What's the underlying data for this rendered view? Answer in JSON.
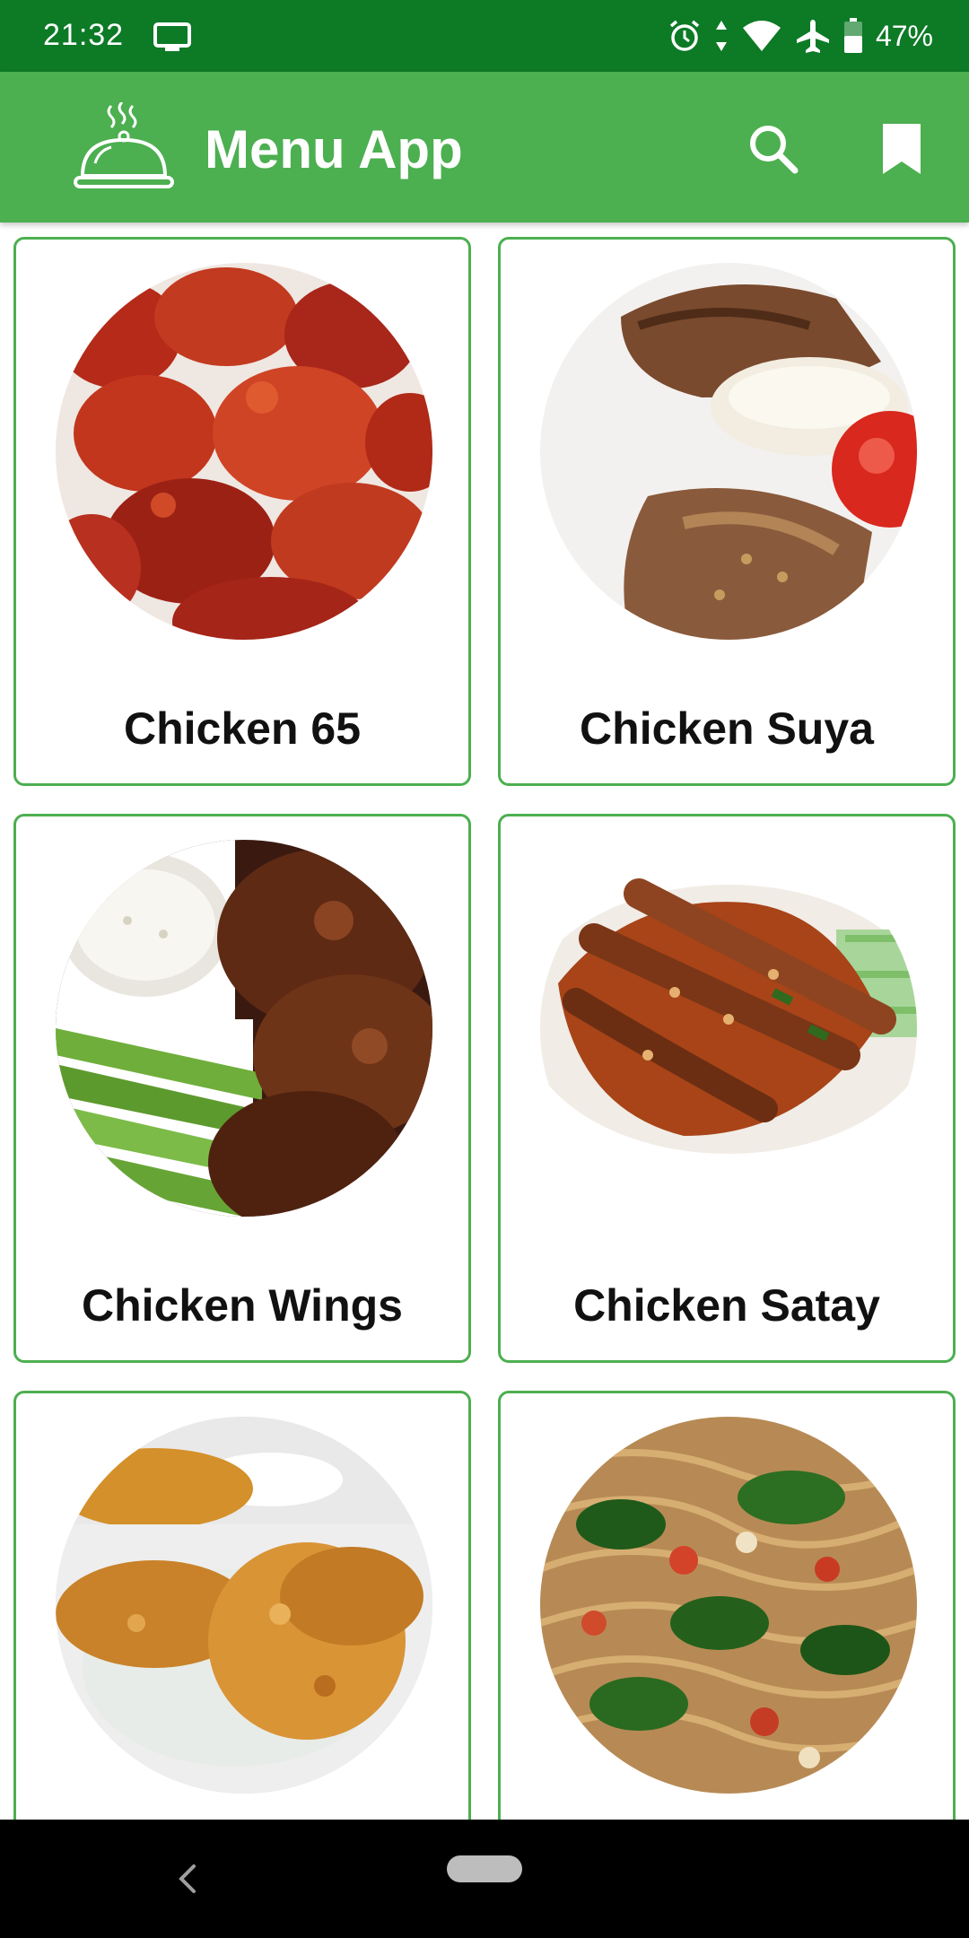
{
  "status_bar": {
    "time": "21:32",
    "battery_percent": "47%",
    "icons": [
      "cast-icon",
      "alarm-icon",
      "data-arrows-icon",
      "wifi-icon",
      "airplane-icon",
      "battery-icon"
    ]
  },
  "app_bar": {
    "title": "Menu App",
    "logo_icon": "food-cloche-icon",
    "actions": [
      "search-icon",
      "bookmark-icon"
    ]
  },
  "menu_items": [
    {
      "name": "Chicken 65"
    },
    {
      "name": "Chicken Suya"
    },
    {
      "name": "Chicken Wings"
    },
    {
      "name": "Chicken Satay"
    },
    {
      "name": ""
    },
    {
      "name": ""
    }
  ],
  "nav_bar": {
    "icons": [
      "back-icon",
      "home-pill-icon"
    ]
  },
  "colors": {
    "status_bar": "#0d7a26",
    "app_bar": "#4caf50",
    "card_border": "#4caf50",
    "nav_bar": "#000000"
  }
}
